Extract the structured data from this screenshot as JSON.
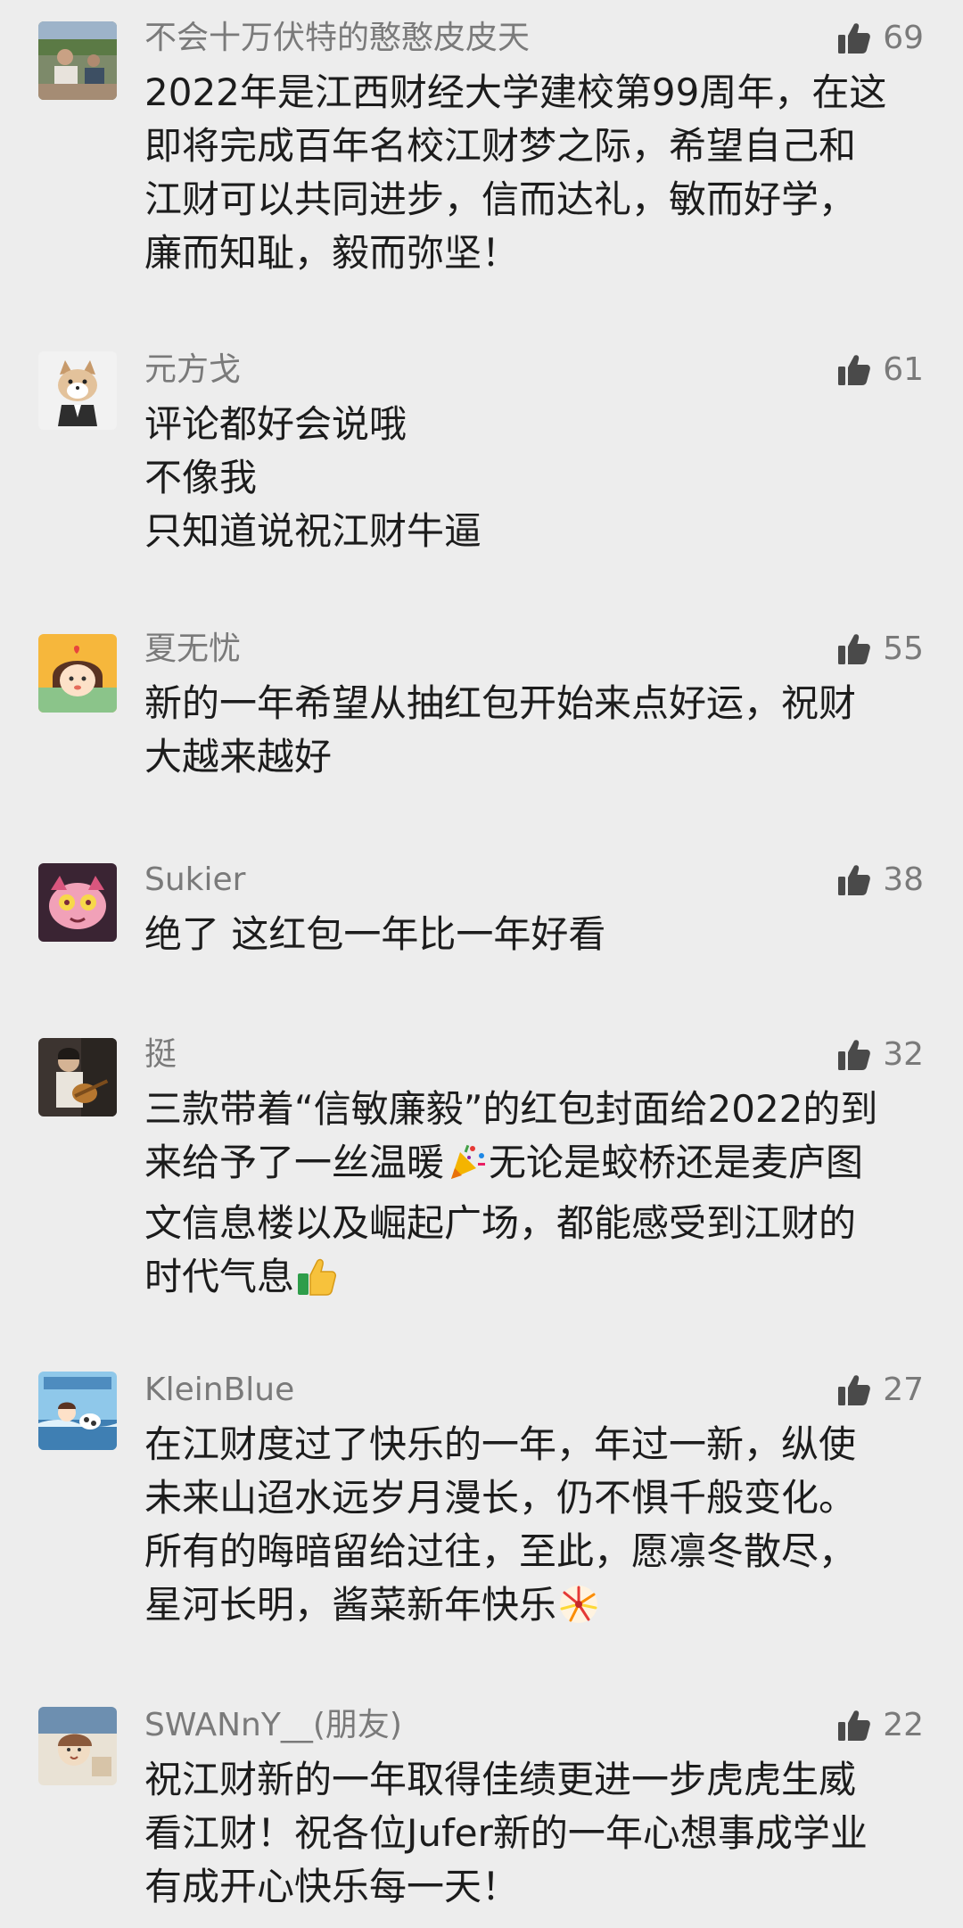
{
  "comments": [
    {
      "user": "不会十万伏特的憨憨皮皮天",
      "likes": "69",
      "avatar": "photo-avatar",
      "lines": [
        "2022年是江西财经大学建校第99周年，在这",
        "即将完成百年名校江财梦之际，希望自己和",
        "江财可以共同进步，信而达礼，敏而好学，",
        "廉而知耻，毅而弥坚！"
      ]
    },
    {
      "user": "元方戈",
      "likes": "61",
      "avatar": "cartoon-dog-avatar",
      "lines": [
        "评论都好会说哦",
        "不像我",
        "只知道说祝江财牛逼"
      ]
    },
    {
      "user": "夏无忧",
      "likes": "55",
      "avatar": "cartoon-girl-avatar",
      "lines": [
        "新的一年希望从抽红包开始来点好运，祝财",
        "大越来越好"
      ]
    },
    {
      "user": "Sukier",
      "likes": "38",
      "avatar": "cartoon-pink-avatar",
      "lines": [
        "绝了 这红包一年比一年好看"
      ]
    },
    {
      "user": "挺",
      "likes": "32",
      "avatar": "guitar-photo-avatar",
      "lines": [
        "三款带着“信敏廉毅”的红包封面给2022的到",
        "来给予了一丝温暖",
        "无论是蛟桥还是麦庐图",
        "文信息楼以及崛起广场，都能感受到江财的",
        "时代气息"
      ]
    },
    {
      "user": "KleinBlue",
      "likes": "27",
      "avatar": "cartoon-sea-avatar",
      "lines": [
        "在江财度过了快乐的一年，年过一新，纵使",
        "未来山迢水远岁月漫长，仍不惧千般变化。",
        "所有的晦暗留给过往，至此，愿凛冬散尽，",
        "星河长明，酱菜新年快乐"
      ]
    },
    {
      "user": "SWANnY__(朋友)",
      "likes": "22",
      "avatar": "sketch-avatar",
      "lines": [
        "祝江财新的一年取得佳绩更进一步虎虎生威",
        "看江财！祝各位Jufer新的一年心想事成学业",
        "有成开心快乐每一天！"
      ]
    }
  ],
  "colors": {
    "background": "#ededed",
    "username": "#7a7a7a",
    "text": "#1c1c1c",
    "like_icon": "#4a4a4a"
  }
}
